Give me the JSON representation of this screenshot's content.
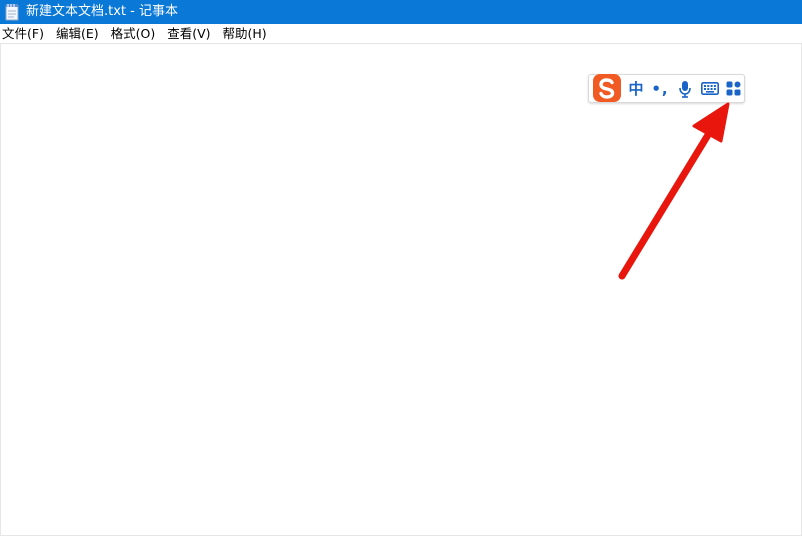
{
  "window": {
    "title": "新建文本文档.txt - 记事本"
  },
  "menu": [
    {
      "label": "文件(F)"
    },
    {
      "label": "编辑(E)"
    },
    {
      "label": "格式(O)"
    },
    {
      "label": "查看(V)"
    },
    {
      "label": "帮助(H)"
    }
  ],
  "ime": {
    "lang_label": "中",
    "punct_label": "•,",
    "icons": [
      "sogou-logo-icon",
      "microphone-icon",
      "keyboard-icon",
      "toolbox-grid-icon"
    ]
  },
  "colors": {
    "titlebar": "#0a78d7",
    "ime_accent": "#1a64c8",
    "logo": "#f15a22",
    "arrow": "#e8160c"
  }
}
